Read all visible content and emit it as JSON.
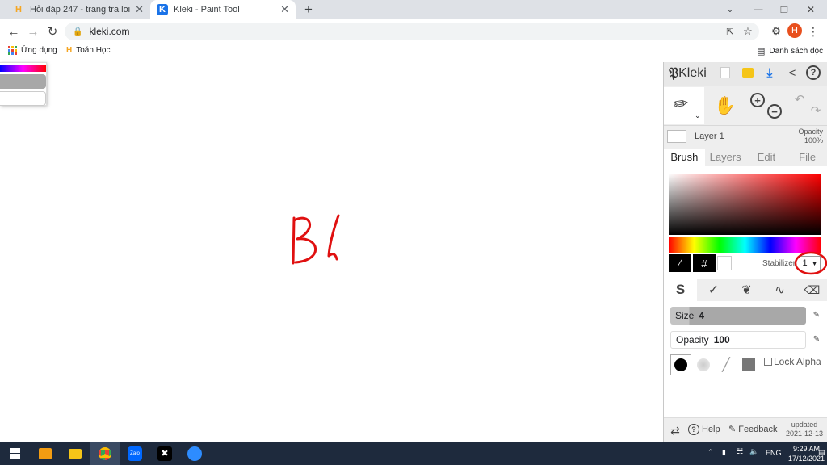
{
  "tabs": [
    {
      "title": "Hỏi đáp 247 - trang tra loi",
      "favicon": "H",
      "favicon_color": "#f5a623",
      "active": false
    },
    {
      "title": "Kleki - Paint Tool",
      "favicon": "K",
      "favicon_color": "#1a73e8",
      "active": true
    }
  ],
  "tab_controls": {
    "new_tab": "+",
    "minimize": "—",
    "maximize": "❐",
    "close": "✕",
    "tab_close": "✕"
  },
  "address": {
    "url": "kleki.com"
  },
  "bookmarks": {
    "apps": "Ứng dụng",
    "toan_hoc": "Toán Học",
    "reading_list": "Danh sách đọc"
  },
  "profile": {
    "initial": "H",
    "color": "#e8501e"
  },
  "canvas": {
    "stroke_color": "#e01010",
    "drawn_text": "Bl"
  },
  "kleki": {
    "logo": "Kleki",
    "layer": {
      "name": "Layer 1",
      "opacity_label": "Opacity",
      "opacity_value": "100%"
    },
    "tabs": [
      "Brush",
      "Layers",
      "Edit",
      "File"
    ],
    "active_tab": "Brush",
    "stabilizer": {
      "label": "Stabilizer",
      "value": "1"
    },
    "hash": "#",
    "size": {
      "label": "Size",
      "value": "4"
    },
    "opacity": {
      "label": "Opacity",
      "value": "100"
    },
    "lock_alpha": "Lock Alpha",
    "footer": {
      "help": "Help",
      "feedback": "Feedback",
      "updated_label": "updated",
      "updated_date": "2021-12-13"
    }
  },
  "taskbar": {
    "lang": "ENG",
    "time": "9:29 AM",
    "date": "17/12/2021",
    "zalo": "Zalo"
  },
  "colors": {
    "accent": "#1a73e8",
    "taskbar": "#1e2a3d",
    "annotation": "#e01010"
  }
}
